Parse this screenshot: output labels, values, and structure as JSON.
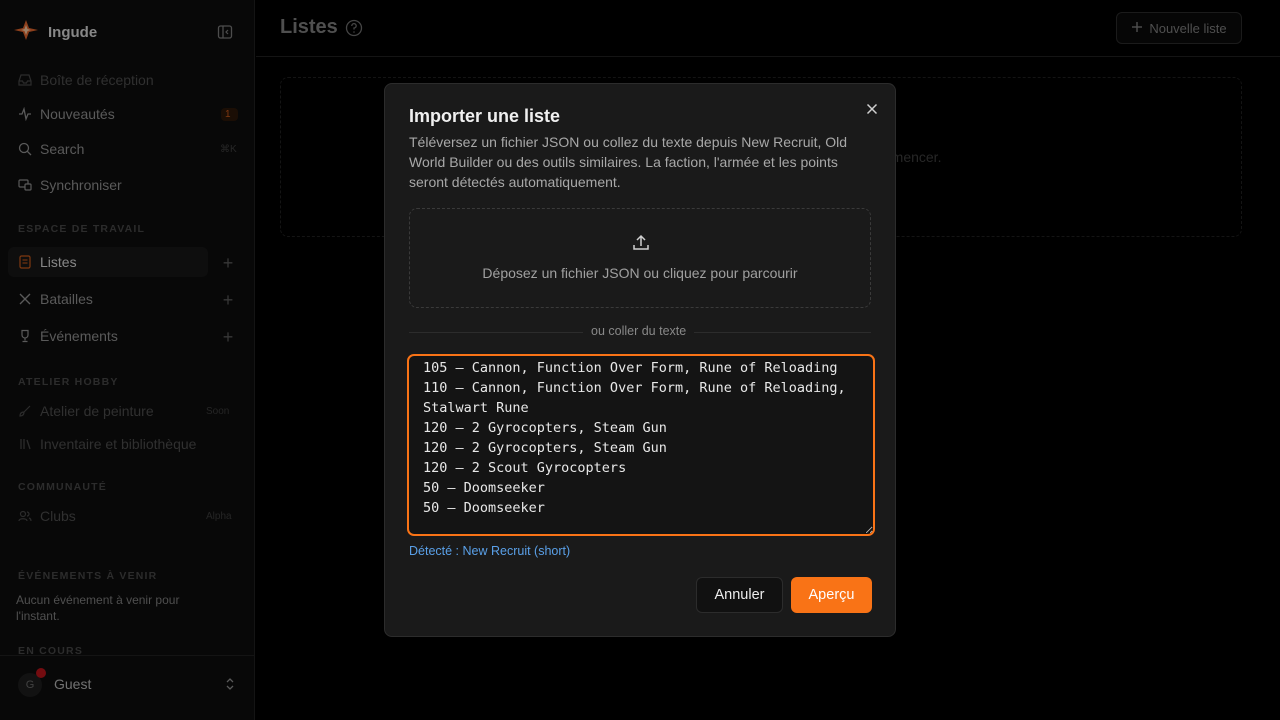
{
  "app": {
    "name": "Ingude"
  },
  "sidebar": {
    "items_top": [
      {
        "label": "Boîte de réception",
        "icon": "inbox-icon"
      },
      {
        "label": "Nouveautés",
        "icon": "activity-icon",
        "badge": "1"
      },
      {
        "label": "Search",
        "icon": "search-icon",
        "shortcut": "⌘K"
      },
      {
        "label": "Synchroniser",
        "icon": "sync-icon"
      }
    ],
    "workspace_title": "ESPACE DE TRAVAIL",
    "workspace": [
      {
        "label": "Listes",
        "icon": "list-icon"
      },
      {
        "label": "Batailles",
        "icon": "swords-icon"
      },
      {
        "label": "Événements",
        "icon": "trophy-icon"
      }
    ],
    "hobby_title": "ATELIER HOBBY",
    "hobby": [
      {
        "label": "Atelier de peinture",
        "icon": "brush-icon",
        "badge": "Soon"
      },
      {
        "label": "Inventaire et bibliothèque",
        "icon": "library-icon"
      }
    ],
    "community_title": "COMMUNAUTÉ",
    "community": [
      {
        "label": "Clubs",
        "icon": "users-icon",
        "badge": "Alpha"
      }
    ],
    "upcoming_title": "ÉVÉNEMENTS À VENIR",
    "upcoming_text": "Aucun événement à venir pour l'instant.",
    "ongoing_title": "EN COURS",
    "user": {
      "initial": "G",
      "name": "Guest"
    }
  },
  "main": {
    "title": "Listes",
    "new_list_label": "Nouvelle liste",
    "empty_text": "mmencer."
  },
  "modal": {
    "title": "Importer une liste",
    "description": "Téléversez un fichier JSON ou collez du texte depuis New Recruit, Old World Builder ou des outils similaires. La faction, l'armée et les points seront détectés automatiquement.",
    "dropzone_text": "Déposez un fichier JSON ou cliquez pour parcourir",
    "divider_text": "ou coller du texte",
    "paste_value": "105 – Cannon, Function Over Form, Rune of Reloading\n110 – Cannon, Function Over Form, Rune of Reloading, Stalwart Rune\n120 – 2 Gyrocopters, Steam Gun\n120 – 2 Gyrocopters, Steam Gun\n120 – 2 Scout Gyrocopters\n50 – Doomseeker\n50 – Doomseeker",
    "detected": "Détecté : New Recruit (short)",
    "cancel_label": "Annuler",
    "preview_label": "Aperçu"
  },
  "colors": {
    "accent": "#f97316",
    "link": "#5aa0e8",
    "modal_bg": "#1a1a1a"
  }
}
